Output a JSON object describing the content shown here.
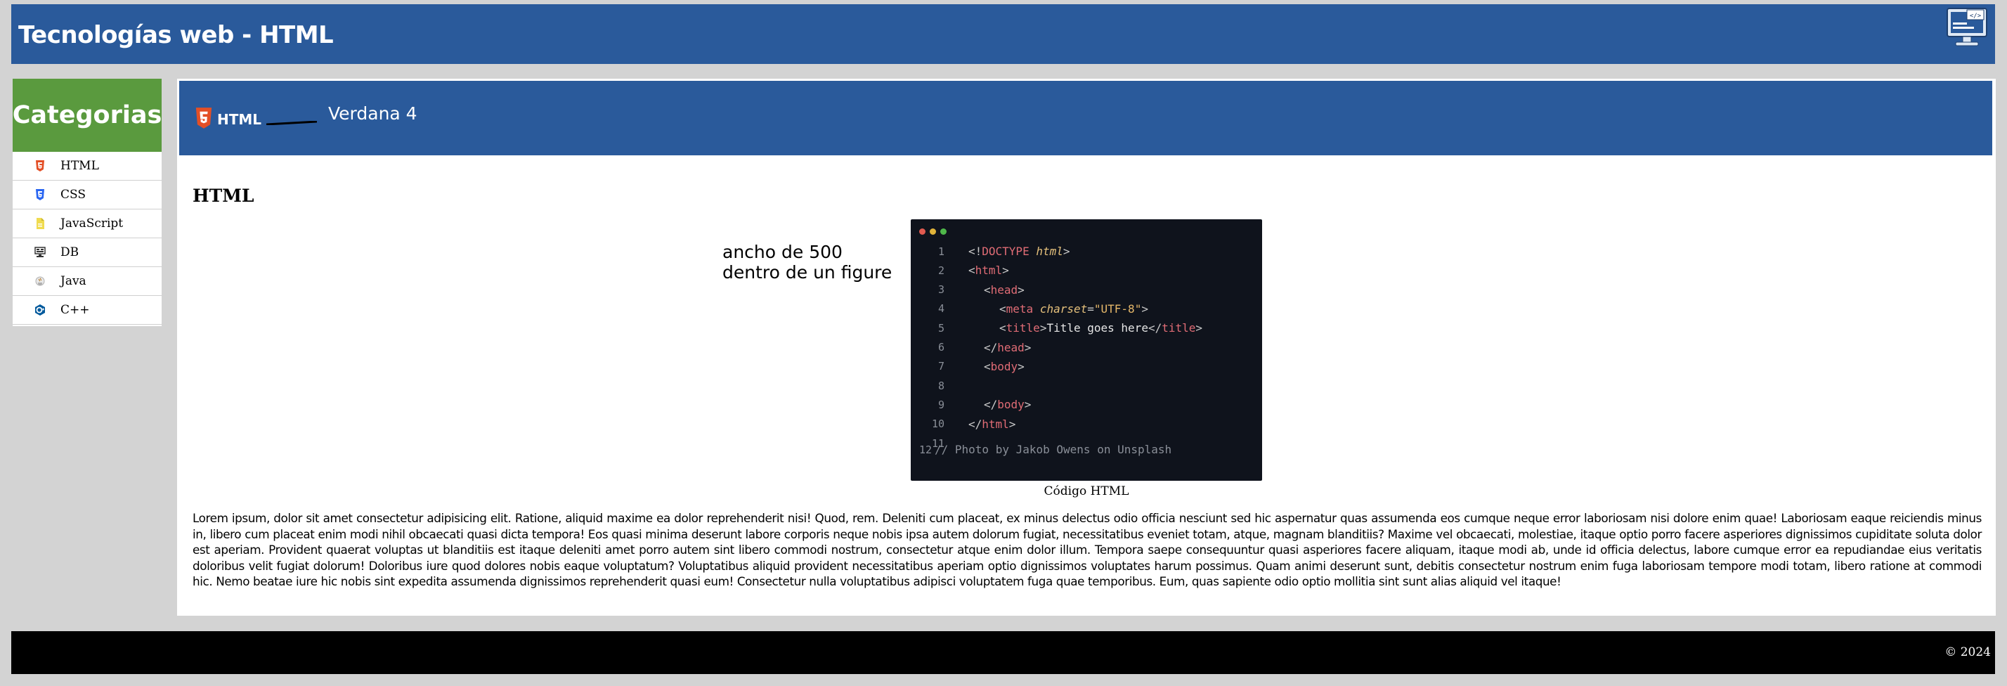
{
  "header": {
    "title": "Tecnologías web - HTML",
    "icon": "code-monitor-icon"
  },
  "sidebar": {
    "title": "Categorias",
    "items": [
      {
        "label": "HTML",
        "icon": "html5-icon",
        "color": "#e34f26"
      },
      {
        "label": "CSS",
        "icon": "css3-icon",
        "color": "#2965f1"
      },
      {
        "label": "JavaScript",
        "icon": "javascript-icon",
        "color": "#f0db4f"
      },
      {
        "label": "DB",
        "icon": "database-icon",
        "color": "#333333"
      },
      {
        "label": "Java",
        "icon": "java-icon",
        "color": "#b0b0b0"
      },
      {
        "label": "C++",
        "icon": "cpp-icon",
        "color": "#00599c"
      }
    ]
  },
  "banner": {
    "logo_text": "HTML",
    "text": "Verdana 4"
  },
  "main": {
    "heading": "HTML",
    "side_note_line1": "ancho de 500",
    "side_note_line2": "dentro de un figure",
    "figure_caption": "Código HTML",
    "code_lines": [
      {
        "n": "1",
        "code": "<!DOCTYPE html>"
      },
      {
        "n": "2",
        "code": "<html>"
      },
      {
        "n": "3",
        "code": "<head>"
      },
      {
        "n": "4",
        "code": "<meta charset=\"UTF-8\">"
      },
      {
        "n": "5",
        "code": "<title>Title goes here</title>"
      },
      {
        "n": "6",
        "code": "</head>"
      },
      {
        "n": "7",
        "code": "<body>"
      },
      {
        "n": "8",
        "code": ""
      },
      {
        "n": "9",
        "code": "</body>"
      },
      {
        "n": "10",
        "code": "</html>"
      },
      {
        "n": "11",
        "code": ""
      },
      {
        "n": "12",
        "code": "// Photo by Jakob Owens on Unsplash"
      }
    ],
    "lorem": "Lorem ipsum, dolor sit amet consectetur adipisicing elit. Ratione, aliquid maxime ea dolor reprehenderit nisi! Quod, rem. Deleniti cum placeat, ex minus delectus odio officia nesciunt sed hic aspernatur quas assumenda eos cumque neque error laboriosam nisi dolore enim quae! Laboriosam eaque reiciendis minus in, libero cum placeat enim modi nihil obcaecati quasi dicta tempora! Eos quasi minima deserunt labore corporis neque nobis ipsa autem dolorum fugiat, necessitatibus eveniet totam, atque, magnam blanditiis? Maxime vel obcaecati, molestiae, itaque optio porro facere asperiores dignissimos cupiditate soluta dolor est aperiam. Provident quaerat voluptas ut blanditiis est itaque deleniti amet porro autem sint libero commodi nostrum, consectetur atque enim dolor illum. Tempora saepe consequuntur quasi asperiores facere aliquam, itaque modi ab, unde id officia delectus, labore cumque error ea repudiandae eius veritatis doloribus velit fugiat dolorum! Doloribus iure quod dolores nobis eaque voluptatum? Voluptatibus aliquid provident necessitatibus aperiam optio dignissimos voluptates harum possimus. Quam animi deserunt sunt, debitis consectetur nostrum enim fuga laboriosam tempore modi totam, libero ratione at commodi hic. Nemo beatae iure hic nobis sint expedita assumenda dignissimos reprehenderit quasi eum! Consectetur nulla voluptatibus adipisci voluptatem fuga quae temporibus. Eum, quas sapiente odio optio mollitia sint sunt alias aliquid vel itaque!"
  },
  "footer": {
    "copyright": "© 2024"
  },
  "colors": {
    "header_bg": "#2a5a9b",
    "sidebar_head_bg": "#5a9a3e",
    "page_bg": "#d3d3d3",
    "footer_bg": "#000000",
    "code_bg": "#0f131c"
  }
}
